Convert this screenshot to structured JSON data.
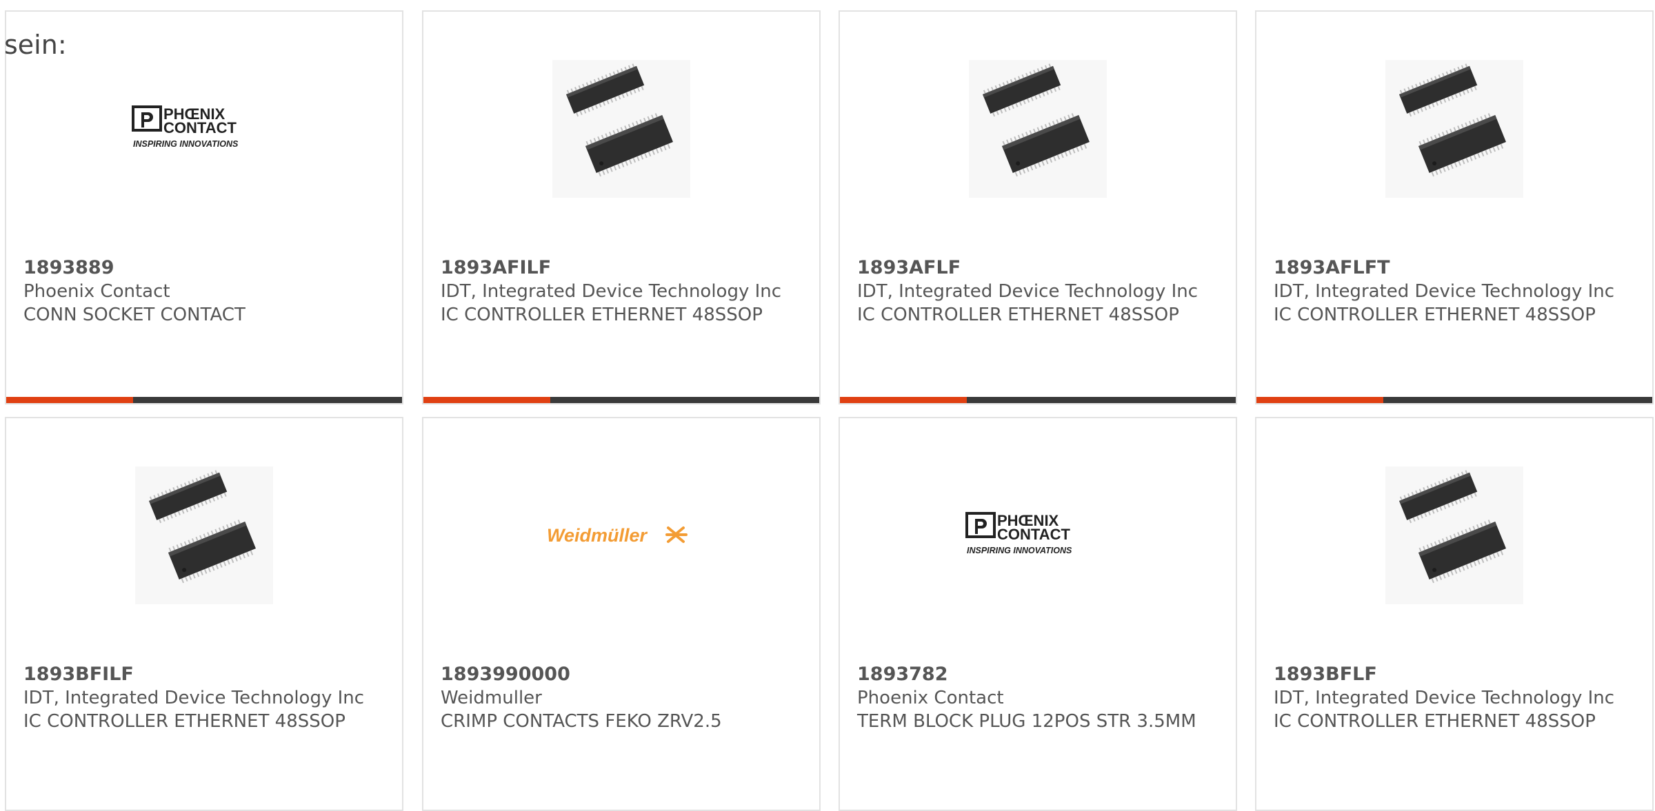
{
  "intro_text": "sein:",
  "colors": {
    "accent": "#e04012",
    "bar": "#3a3a3a",
    "border": "#e2e2e2",
    "text": "#555555",
    "weidmuller": "#f39c34"
  },
  "products": [
    {
      "part_number": "1893889",
      "manufacturer": "Phoenix Contact",
      "description": "CONN SOCKET CONTACT",
      "image": "phoenix-contact-logo"
    },
    {
      "part_number": "1893AFILF",
      "manufacturer": "IDT, Integrated Device Technology Inc",
      "description": "IC CONTROLLER ETHERNET 48SSOP",
      "image": "ssop-chip"
    },
    {
      "part_number": "1893AFLF",
      "manufacturer": "IDT, Integrated Device Technology Inc",
      "description": "IC CONTROLLER ETHERNET 48SSOP",
      "image": "ssop-chip"
    },
    {
      "part_number": "1893AFLFT",
      "manufacturer": "IDT, Integrated Device Technology Inc",
      "description": "IC CONTROLLER ETHERNET 48SSOP",
      "image": "ssop-chip"
    },
    {
      "part_number": "1893BFILF",
      "manufacturer": "IDT, Integrated Device Technology Inc",
      "description": "IC CONTROLLER ETHERNET 48SSOP",
      "image": "ssop-chip"
    },
    {
      "part_number": "1893990000",
      "manufacturer": "Weidmuller",
      "description": "CRIMP CONTACTS FEKO ZRV2.5",
      "image": "weidmuller-logo"
    },
    {
      "part_number": "1893782",
      "manufacturer": "Phoenix Contact",
      "description": "TERM BLOCK PLUG 12POS STR 3.5MM",
      "image": "phoenix-contact-logo"
    },
    {
      "part_number": "1893BFLF",
      "manufacturer": "IDT, Integrated Device Technology Inc",
      "description": "IC CONTROLLER ETHERNET 48SSOP",
      "image": "ssop-chip"
    }
  ],
  "logos": {
    "phoenix_line1": "PHŒNIX",
    "phoenix_line2": "CONTACT",
    "phoenix_tagline": "INSPIRING INNOVATIONS",
    "weidmuller": "Weidmüller"
  }
}
